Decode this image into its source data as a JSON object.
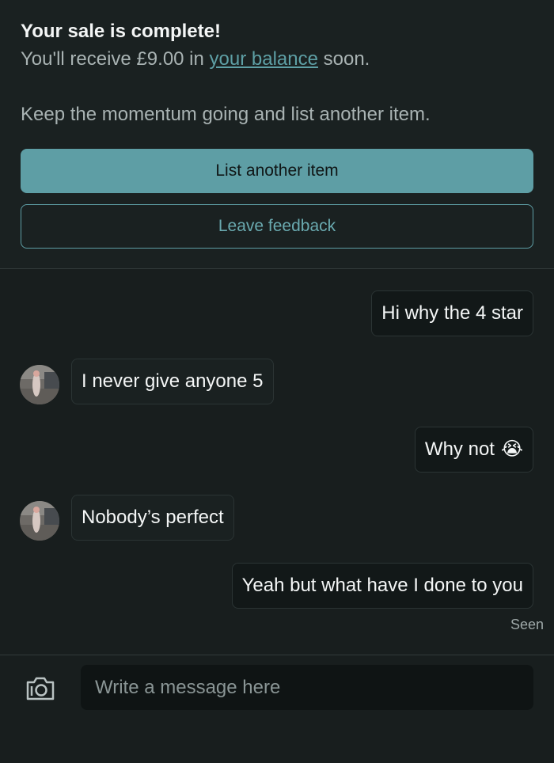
{
  "sale": {
    "title": "Your sale is complete!",
    "receive_prefix": "You'll receive £9.00 in ",
    "balance_link": "your balance",
    "receive_suffix": " soon.",
    "prompt": "Keep the momentum going and list another item.",
    "primary_button": "List another item",
    "secondary_button": "Leave feedback"
  },
  "conversation": {
    "messages": [
      {
        "direction": "outgoing",
        "text": "Hi why the 4 star"
      },
      {
        "direction": "incoming",
        "text": "I never give anyone 5"
      },
      {
        "direction": "outgoing",
        "text": "Why not",
        "emoji": "😭"
      },
      {
        "direction": "incoming",
        "text": "Nobody’s perfect"
      },
      {
        "direction": "outgoing",
        "text": "Yeah but what have I done to you"
      }
    ],
    "status": "Seen"
  },
  "composer": {
    "placeholder": "Write a message here",
    "camera_icon": "camera-icon"
  },
  "colors": {
    "accent": "#5e9ea5",
    "background": "#181e1e",
    "bubble": "#121818"
  }
}
